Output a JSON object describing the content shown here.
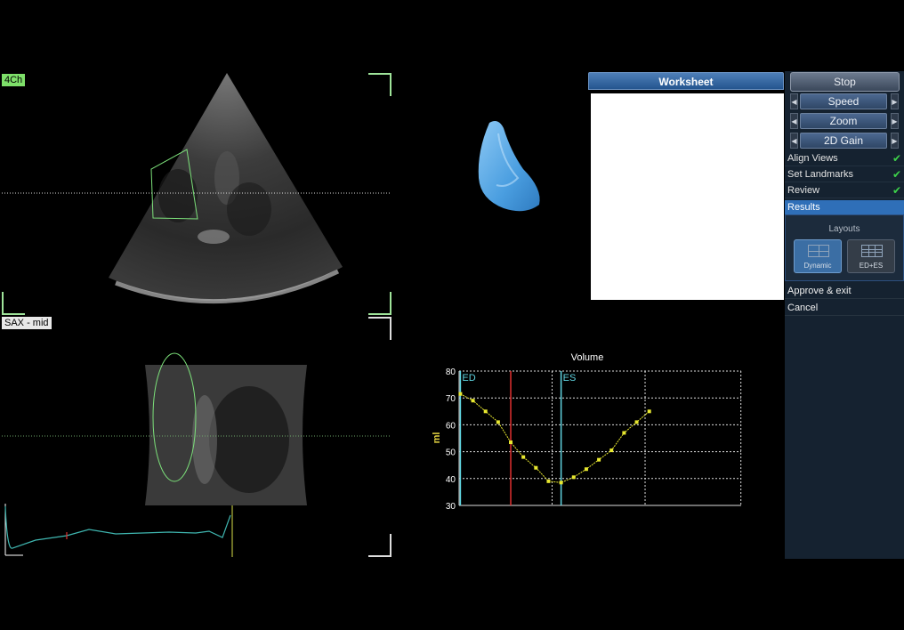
{
  "views": {
    "top_label": "4Ch",
    "bottom_label": "SAX - mid"
  },
  "worksheet": {
    "title": "Worksheet"
  },
  "controls": {
    "stop": "Stop",
    "speed": "Speed",
    "zoom": "Zoom",
    "gain": "2D Gain"
  },
  "steps": [
    {
      "label": "Align Views",
      "done": true
    },
    {
      "label": "Set Landmarks",
      "done": true
    },
    {
      "label": "Review",
      "done": true
    }
  ],
  "results": {
    "header": "Results",
    "layouts_title": "Layouts",
    "layout_options": [
      {
        "label": "Dynamic",
        "selected": true
      },
      {
        "label": "ED+ES",
        "selected": false
      }
    ]
  },
  "actions": {
    "approve": "Approve & exit",
    "cancel": "Cancel"
  },
  "colors": {
    "accent": "#2f6fb8",
    "curve": "#e8e830",
    "marker": "#5fd4e0",
    "cursor": "#e03030",
    "check": "#3dd24a"
  },
  "chart_data": {
    "type": "line",
    "title": "Volume",
    "xlabel": "",
    "ylabel": "ml",
    "ylim": [
      30,
      80
    ],
    "yticks": [
      30,
      40,
      50,
      60,
      70,
      80
    ],
    "x": [
      1,
      2,
      3,
      4,
      5,
      6,
      7,
      8,
      9,
      10,
      11,
      12,
      13,
      14,
      15,
      16
    ],
    "series": [
      {
        "values": [
          71.5,
          69,
          65,
          61,
          53.5,
          48,
          44,
          39,
          38.5,
          40.5,
          43.5,
          47,
          50.5,
          57,
          61,
          65
        ]
      }
    ],
    "markers": [
      {
        "label": "ED",
        "x": 1
      },
      {
        "label": "ES",
        "x": 9
      }
    ],
    "cursor_x": 5,
    "grid": true
  }
}
